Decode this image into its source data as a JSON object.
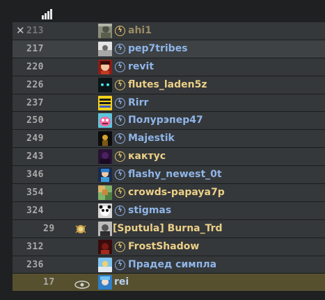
{
  "scoreboard": {
    "header_icon": "ping-signal-icon",
    "colors": {
      "ct_name": "#8fb5e8",
      "t_name": "#ecd088",
      "ping": "#a9a9a9",
      "self_row": "#56502f"
    },
    "players": [
      {
        "ping": "213",
        "name": "ahi1",
        "team": "t",
        "status": "dead",
        "marker": "✕",
        "avatar": "avatar-soldier"
      },
      {
        "ping": "217",
        "name": "pep7tribes",
        "team": "ct",
        "avatar": "avatar-white"
      },
      {
        "ping": "220",
        "name": "revit",
        "team": "ct",
        "avatar": "avatar-red"
      },
      {
        "ping": "226",
        "name": "flutes_laden5z",
        "team": "t",
        "avatar": "avatar-dark-eyes"
      },
      {
        "ping": "237",
        "name": "Rirr",
        "team": "ct",
        "avatar": "avatar-yellow-text"
      },
      {
        "ping": "250",
        "name": "Полурэпер47",
        "team": "ct",
        "avatar": "avatar-pink-cartoon"
      },
      {
        "ping": "249",
        "name": "Majestik",
        "team": "ct",
        "avatar": "avatar-black-gold"
      },
      {
        "ping": "243",
        "name": "кактус",
        "team": "t",
        "avatar": "avatar-purple"
      },
      {
        "ping": "346",
        "name": "flashy_newest_0t",
        "team": "ct",
        "avatar": "avatar-anime"
      },
      {
        "ping": "354",
        "name": "crowds-papaya7p",
        "team": "t",
        "avatar": "avatar-pixel"
      },
      {
        "ping": "324",
        "name": "stigmas",
        "team": "ct",
        "avatar": "avatar-panda"
      },
      {
        "ping": "29",
        "name": "[Sputula] Burna_Trd",
        "team": "t",
        "badge": "gold-medal-icon",
        "avatar": "avatar-bw-portrait"
      },
      {
        "ping": "312",
        "name": "FrostShadow",
        "team": "t",
        "avatar": "avatar-red-dark"
      },
      {
        "ping": "236",
        "name": "Прадед симпла",
        "team": "ct",
        "avatar": "avatar-blue-sky"
      },
      {
        "ping": "17",
        "name": "rei",
        "team": "ct",
        "self": true,
        "badge": "eye-icon",
        "avatar": "avatar-blue-hair"
      }
    ]
  }
}
